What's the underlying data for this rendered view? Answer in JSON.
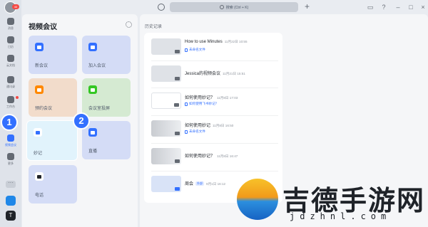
{
  "rail": {
    "badge": "40",
    "items": [
      {
        "label": "消息"
      },
      {
        "label": "日历"
      },
      {
        "label": "云文档"
      },
      {
        "label": "通讯录"
      },
      {
        "label": "工作台"
      },
      {
        "label": "视频会议"
      },
      {
        "label": "更多"
      }
    ],
    "app2_glyph": "T"
  },
  "titlebar": {
    "search_placeholder": "搜索 (Ctrl + K)"
  },
  "meetings": {
    "title": "视频会议",
    "tiles": [
      {
        "label": "新会议",
        "color": "#d4dcf6",
        "icon_color": "#3370ff"
      },
      {
        "label": "加入会议",
        "color": "#d4dcf6",
        "icon_color": "#3370ff"
      },
      {
        "label": "预约会议",
        "color": "#f2dccb",
        "icon_color": "#ff8800"
      },
      {
        "label": "会议室投屏",
        "color": "#d5ead2",
        "icon_color": "#34c724"
      },
      {
        "label": "妙记",
        "color": "#e1f3fc",
        "icon_color": "#3370ff"
      },
      {
        "label": "直播",
        "color": "#d4dcf6",
        "icon_color": "#3370ff"
      },
      {
        "label": "电话",
        "color": "#d4dcf6",
        "icon_color": "#1f2329"
      }
    ],
    "steps": [
      "1",
      "2"
    ]
  },
  "history": {
    "label": "历史记录",
    "records": [
      {
        "title": "How to use Minutes",
        "date": "11月22日 10:55",
        "doc": "未命名文件"
      },
      {
        "title": "Jessica的视频会议",
        "date": "11月21日 15:51"
      },
      {
        "title": "如何使用妙记？",
        "date": "11月8日 17:03",
        "doc": "如何使用飞书妙记？"
      },
      {
        "title": "如何使用妙记",
        "date": "11月8日 16:50",
        "doc": "未命名文件"
      },
      {
        "title": "如何使用妙记？",
        "date": "11月8日 16:47"
      },
      {
        "title": "周会",
        "badge": "外部",
        "date": "9月1日 16:12"
      }
    ]
  },
  "watermark": {
    "title": "吉德手游网",
    "url": "jdzhnl.com"
  }
}
